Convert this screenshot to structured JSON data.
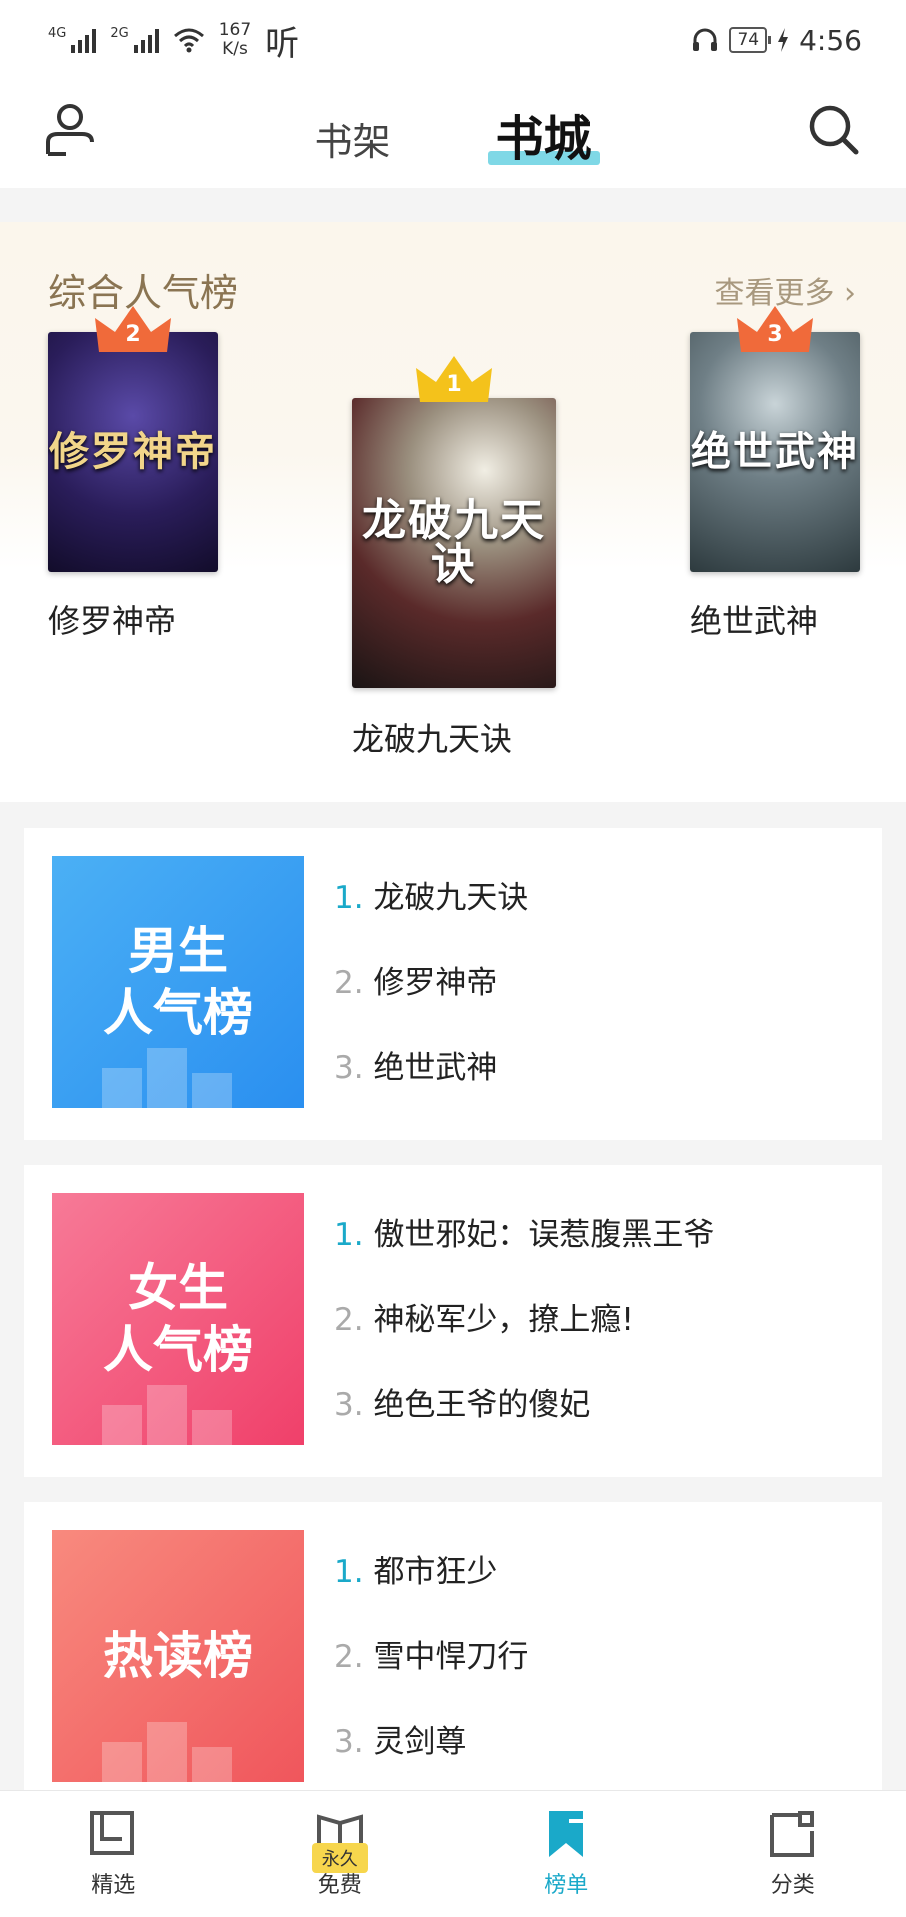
{
  "status_bar": {
    "signal1": "4G",
    "signal2": "2G",
    "speed_value": "167",
    "speed_unit": "K/s",
    "ting": "听",
    "battery": "74",
    "time": "4:56"
  },
  "top_nav": {
    "tabs": [
      {
        "label": "书架",
        "active": false
      },
      {
        "label": "书城",
        "active": true
      }
    ]
  },
  "banner": {
    "title": "综合人气榜",
    "more": "查看更多 ›",
    "books": [
      {
        "rank": "2",
        "name": "修罗神帝",
        "cover_text": "修罗神帝",
        "crown_color": "#f06a3a"
      },
      {
        "rank": "1",
        "name": "龙破九天诀",
        "cover_text": "龙破九天诀",
        "crown_color": "#f4c21b"
      },
      {
        "rank": "3",
        "name": "绝世武神",
        "cover_text": "绝世武神",
        "crown_color": "#f06a3a"
      }
    ]
  },
  "rank_cards": [
    {
      "tile_line1": "男生",
      "tile_line2": "人气榜",
      "tile_color": "#3ea0f2",
      "items": [
        {
          "num": "1.",
          "title": "龙破九天诀"
        },
        {
          "num": "2.",
          "title": "修罗神帝"
        },
        {
          "num": "3.",
          "title": "绝世武神"
        }
      ]
    },
    {
      "tile_line1": "女生",
      "tile_line2": "人气榜",
      "tile_color": "#f2567a",
      "items": [
        {
          "num": "1.",
          "title": "傲世邪妃：误惹腹黑王爷"
        },
        {
          "num": "2.",
          "title": "神秘军少，撩上瘾!"
        },
        {
          "num": "3.",
          "title": "绝色王爷的傻妃"
        }
      ]
    },
    {
      "tile_line1": "热读榜",
      "tile_line2": "",
      "tile_color": "#f26b6b",
      "items": [
        {
          "num": "1.",
          "title": "都市狂少"
        },
        {
          "num": "2.",
          "title": "雪中悍刀行"
        },
        {
          "num": "3.",
          "title": "灵剑尊"
        }
      ]
    }
  ],
  "bottom_nav": {
    "items": [
      {
        "label": "精选",
        "icon": "featured-icon",
        "active": false
      },
      {
        "label": "免费",
        "icon": "free-book-icon",
        "badge": "永久",
        "active": false
      },
      {
        "label": "榜单",
        "icon": "ranking-bookmark-icon",
        "active": true
      },
      {
        "label": "分类",
        "icon": "category-icon",
        "active": false
      }
    ]
  },
  "colors": {
    "accent": "#1aa9c9",
    "banner_title": "#8a7452"
  }
}
